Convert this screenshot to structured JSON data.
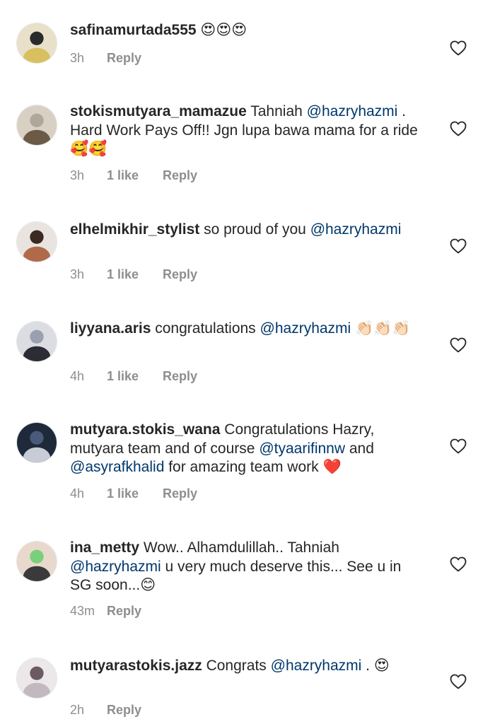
{
  "comments": [
    {
      "username": "safinamurtada555",
      "parts": [
        {
          "t": "text",
          "v": " 😍😍😍"
        }
      ],
      "time": "3h",
      "likes": "",
      "reply": "Reply",
      "avatar_colors": [
        "#e8e0c8",
        "#d8c060",
        "#2a2a2a"
      ]
    },
    {
      "username": "stokismutyara_mamazue",
      "parts": [
        {
          "t": "text",
          "v": " Tahniah "
        },
        {
          "t": "mention",
          "v": "@hazryhazmi"
        },
        {
          "t": "text",
          "v": " . Hard Work Pays Off!! Jgn lupa bawa mama for a ride🥰🥰"
        }
      ],
      "time": "3h",
      "likes": "1 like",
      "reply": "Reply",
      "avatar_colors": [
        "#d9d0c4",
        "#6b5a48",
        "#b0a69a"
      ]
    },
    {
      "username": "elhelmikhir_stylist",
      "parts": [
        {
          "t": "text",
          "v": " so proud of you "
        },
        {
          "t": "mention",
          "v": "@hazryhazmi"
        }
      ],
      "time": "3h",
      "likes": "1 like",
      "reply": "Reply",
      "avatar_colors": [
        "#e9e4df",
        "#b06a4a",
        "#3a2a22"
      ]
    },
    {
      "username": "liyyana.aris",
      "parts": [
        {
          "t": "text",
          "v": " congratulations "
        },
        {
          "t": "mention",
          "v": "@hazryhazmi"
        },
        {
          "t": "text",
          "v": " 👏🏻👏🏻👏🏻"
        }
      ],
      "time": "4h",
      "likes": "1 like",
      "reply": "Reply",
      "avatar_colors": [
        "#dcdde2",
        "#2c2c34",
        "#9aa0b0"
      ]
    },
    {
      "username": "mutyara.stokis_wana",
      "parts": [
        {
          "t": "text",
          "v": " Congratulations Hazry, mutyara team and of course "
        },
        {
          "t": "mention",
          "v": "@tyaarifinnw"
        },
        {
          "t": "text",
          "v": " and "
        },
        {
          "t": "mention",
          "v": "@asyrafkhalid"
        },
        {
          "t": "text",
          "v": " for amazing team work ❤️"
        }
      ],
      "time": "4h",
      "likes": "1 like",
      "reply": "Reply",
      "avatar_colors": [
        "#1e2a3a",
        "#c8ccd6",
        "#4a5a7a"
      ]
    },
    {
      "username": "ina_metty",
      "parts": [
        {
          "t": "text",
          "v": " Wow.. Alhamdulillah.. Tahniah "
        },
        {
          "t": "mention",
          "v": "@hazryhazmi"
        },
        {
          "t": "text",
          "v": " u very much deserve this... See u in SG soon...😊"
        }
      ],
      "time": "43m",
      "likes": "",
      "reply": "Reply",
      "avatar_colors": [
        "#e9d8cc",
        "#3a3a3a",
        "#7ad07a"
      ]
    },
    {
      "username": "mutyarastokis.jazz",
      "parts": [
        {
          "t": "text",
          "v": " Congrats "
        },
        {
          "t": "mention",
          "v": "@hazryhazmi"
        },
        {
          "t": "text",
          "v": " . 😍"
        }
      ],
      "time": "2h",
      "likes": "",
      "reply": "Reply",
      "avatar_colors": [
        "#ece8ea",
        "#c4b8c0",
        "#6a5a62"
      ]
    }
  ],
  "colors": {
    "mention": "#00376b",
    "meta": "#8e8e8e",
    "text": "#262626"
  },
  "icons": {
    "like": "heart-outline-icon"
  }
}
